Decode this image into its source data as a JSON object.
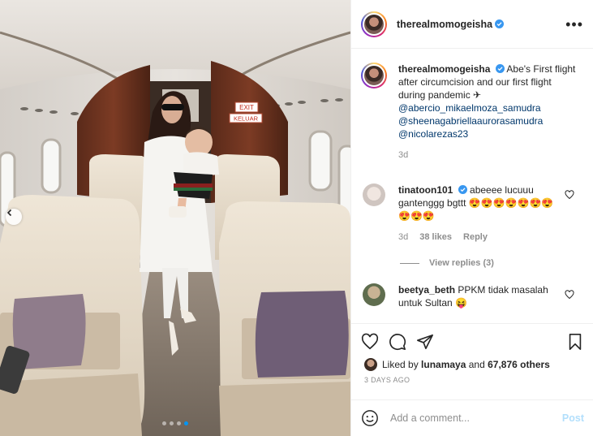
{
  "post": {
    "username": "therealmomogeisha",
    "more_label": "•••",
    "caption": {
      "username": "therealmomogeisha",
      "text_1": "Abe's First flight after circumcision and our first flight during pandemic ✈",
      "mentions": [
        "@abercio_mikaelmoza_samudra",
        "@sheenagabriellaaurorasamudra",
        "@nicolarezas23"
      ],
      "age": "3d"
    },
    "comments": [
      {
        "username": "tinatoon101",
        "text": "abeeee lucuuu gantenggg bgttt 😍😍😍😍😍😍😍😍😍😍",
        "age": "3d",
        "likes": "38 likes",
        "reply": "Reply",
        "view_replies": "View replies (3)"
      },
      {
        "username": "beetya_beth",
        "text": "PPKM tidak masalah untuk Sultan 😝",
        "age": "",
        "likes": "",
        "reply": ""
      }
    ],
    "liked_by": {
      "prefix": "Liked by ",
      "user": "lunamaya",
      "suffix": " and ",
      "others": "67,876 others"
    },
    "timestamp": "3 DAYS AGO",
    "add_comment_placeholder": "Add a comment...",
    "post_button": "Post",
    "sign_exit": "EXIT",
    "sign_keluar": "KELUAR"
  },
  "carousel": {
    "total": 4,
    "active": 4
  },
  "colors": {
    "accent": "#0095f6",
    "mention": "#00376b",
    "muted": "#8e8e8e",
    "post_disabled": "#b2dffc"
  }
}
